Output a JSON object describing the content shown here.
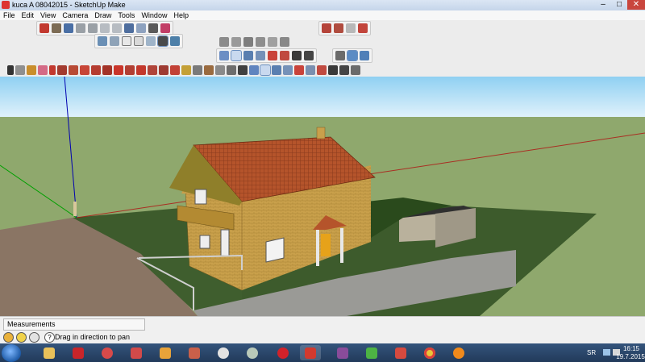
{
  "window": {
    "title": "kuca A 08042015 - SketchUp Make",
    "minimize": "–",
    "maximize": "□",
    "close": "✕"
  },
  "menu": [
    "File",
    "Edit",
    "View",
    "Camera",
    "Draw",
    "Tools",
    "Window",
    "Help"
  ],
  "toolbars": {
    "getting_started": [
      "model-info",
      "components",
      "save",
      "cut",
      "copy",
      "paste",
      "erase",
      "undo",
      "redo",
      "print",
      "user"
    ],
    "views": [
      "iso",
      "top",
      "front",
      "right",
      "back",
      "left"
    ],
    "styles": [
      "xray",
      "back-edges",
      "wireframe",
      "hidden-line",
      "shaded",
      "shaded-textures",
      "monochrome"
    ],
    "warehouse": [
      "get-models",
      "share-model",
      "share-component",
      "extension-warehouse"
    ],
    "camera": [
      "orbit",
      "pan",
      "zoom",
      "zoom-window",
      "zoom-extents",
      "position-camera",
      "walk",
      "look-around",
      "section-plane",
      "section-display",
      "section-fill"
    ],
    "large_tool_set": [
      "select",
      "make-component",
      "paint",
      "eraser",
      "line",
      "arc",
      "freehand",
      "rectangle",
      "circle",
      "polygon",
      "move",
      "push-pull",
      "rotate",
      "follow-me",
      "scale",
      "offset",
      "tape",
      "text",
      "axes",
      "dimension",
      "protractor",
      "3d-text",
      "orbit",
      "pan",
      "zoom",
      "zoom-window",
      "zoom-extents",
      "prev",
      "position-camera",
      "walk",
      "look-around",
      "section"
    ]
  },
  "status": {
    "measurements_label": "Measurements",
    "hint": "Drag in direction to pan",
    "help_icon": "?"
  },
  "taskbar": {
    "apps": [
      "explorer",
      "acrobat",
      "media-center",
      "sketchup-layout",
      "media-player",
      "photo-viewer",
      "imaging",
      "dvd",
      "opera",
      "sketchup",
      "winrar",
      "utorrent",
      "style-builder",
      "chrome",
      "vlc"
    ],
    "language": "SR",
    "time": "16:15",
    "date": "19.7.2015"
  },
  "colors": {
    "sky": "#a8d5ee",
    "ground": "#8fa86d",
    "roof": "#b5542b",
    "wall": "#c9a04b",
    "lot": "#3a5a2a",
    "road": "#8a7564",
    "axis_red": "#b01010",
    "axis_blue": "#0000b0",
    "axis_green": "#00a000"
  }
}
